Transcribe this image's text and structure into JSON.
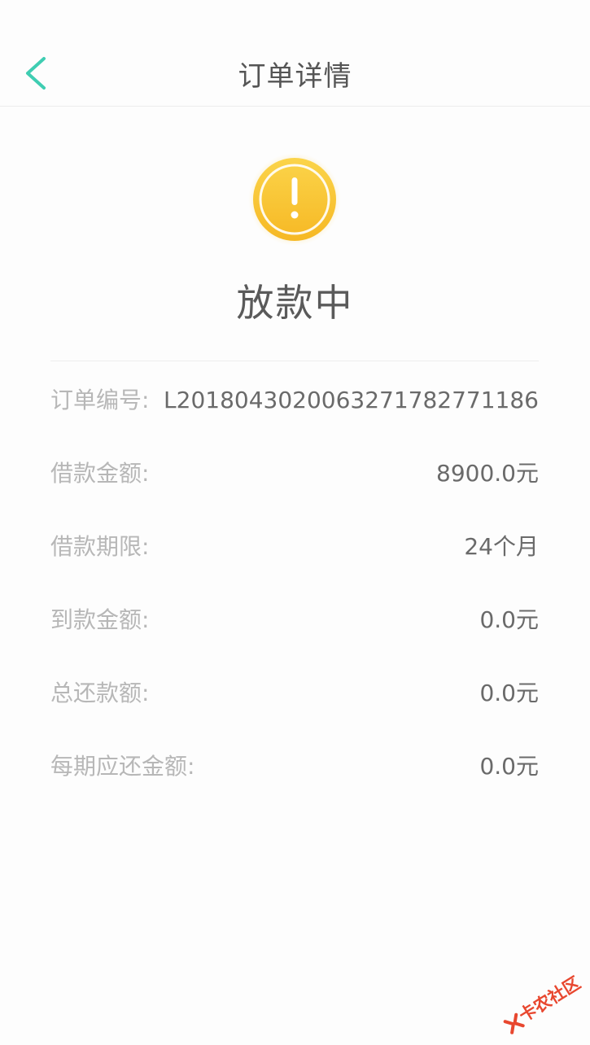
{
  "navbar": {
    "title": "订单详情",
    "back_icon": "chevron-left-icon",
    "accent_color": "#3fcdb2"
  },
  "status": {
    "icon": "warning-exclamation-icon",
    "icon_color": "#f7c12b",
    "text": "放款中"
  },
  "details": {
    "order_no": {
      "label": "订单编号:",
      "value": "L2018043020063271782771186"
    },
    "loan_amount": {
      "label": "借款金额:",
      "value": "8900.0元"
    },
    "loan_term": {
      "label": "借款期限:",
      "value": "24个月"
    },
    "received_amount": {
      "label": "到款金额:",
      "value": "0.0元"
    },
    "total_repay": {
      "label": "总还款额:",
      "value": "0.0元"
    },
    "per_period_repay": {
      "label": "每期应还金额:",
      "value": "0.0元"
    }
  },
  "watermark": {
    "text": "卡农社区",
    "icon": "kanong-logo-icon",
    "color": "#e8472f"
  }
}
